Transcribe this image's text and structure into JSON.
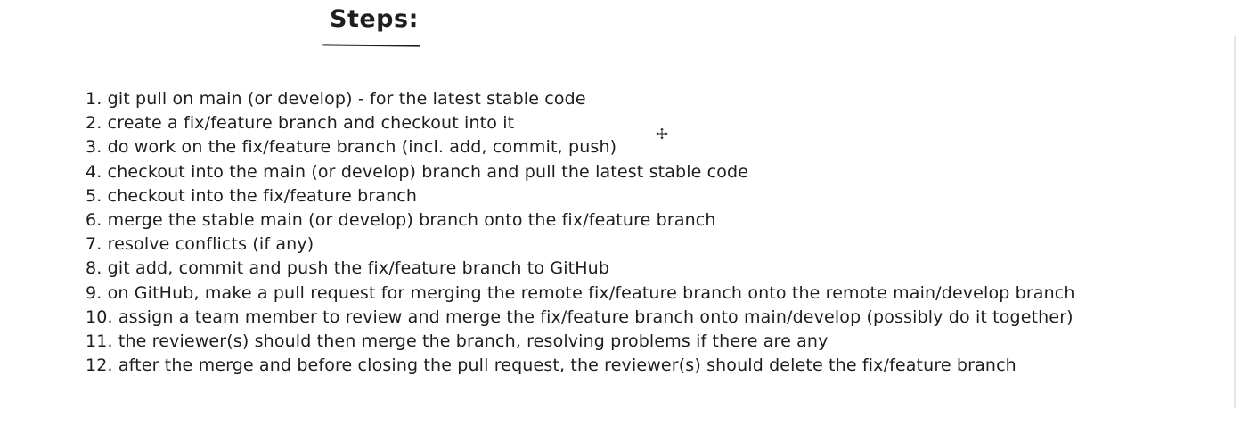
{
  "heading": "Steps:",
  "steps": [
    "1. git pull on main (or develop) - for the latest stable code",
    "2. create a fix/feature branch and checkout into it",
    "3. do work on the fix/feature branch (incl. add, commit, push)",
    "4. checkout into the main (or develop) branch and pull the latest stable code",
    "5. checkout into the fix/feature branch",
    "6. merge the stable main (or develop) branch onto the fix/feature branch",
    "7. resolve conflicts (if any)",
    "8. git add, commit and push the fix/feature branch to GitHub",
    "9. on GitHub, make a pull request for merging the remote fix/feature branch onto the remote main/develop branch",
    "10. assign a team member to review and merge the fix/feature branch onto main/develop (possibly do it together)",
    "11. the reviewer(s) should then merge the branch, resolving problems if there are any",
    "12. after the merge and before closing the pull request, the reviewer(s) should delete the fix/feature branch"
  ],
  "cursor_icon": "move-cursor-icon",
  "colors": {
    "ink": "#1e1e1e",
    "background": "#ffffff"
  }
}
